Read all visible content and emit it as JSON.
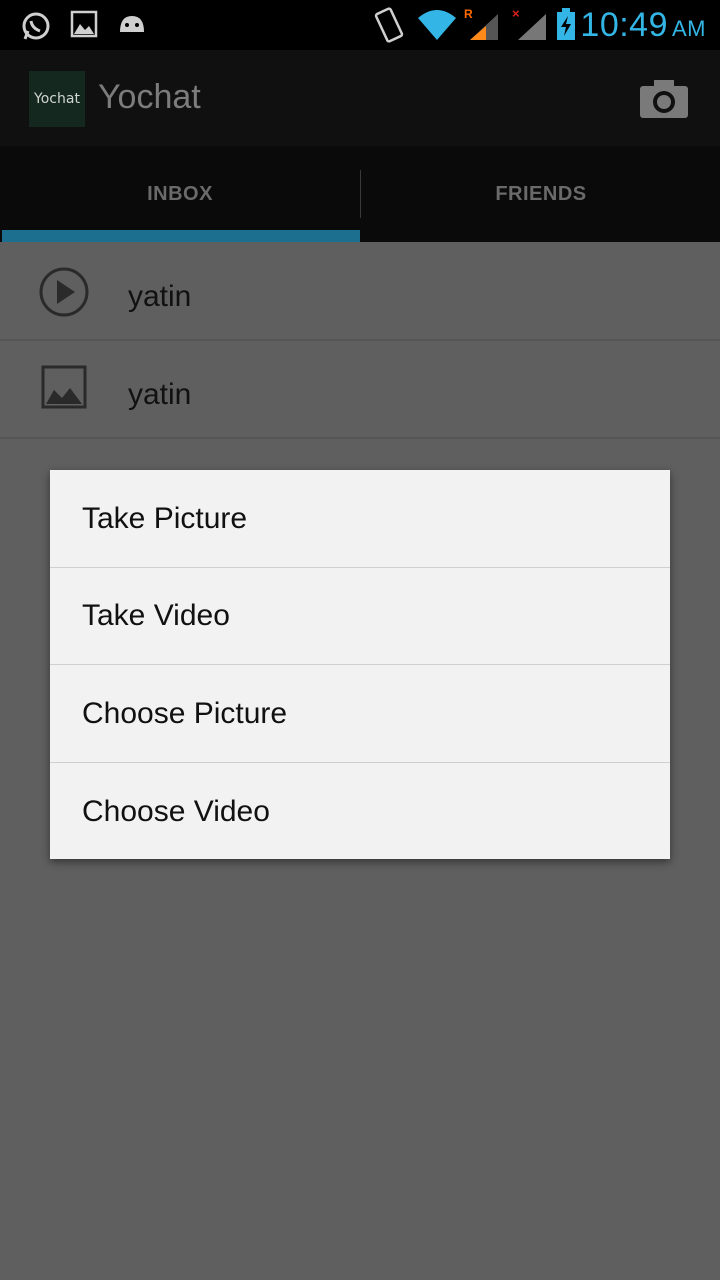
{
  "status_bar": {
    "icons": [
      "whatsapp-icon",
      "image-icon",
      "android-icon",
      "vibrate-icon",
      "wifi-icon",
      "signal-roaming-icon",
      "signal-noservice-icon",
      "battery-charging-icon"
    ],
    "time": "10:49",
    "ampm": "AM",
    "accent_color": "#33b5e5"
  },
  "action_bar": {
    "logo_text": "Yochat",
    "title": "Yochat",
    "camera_icon": "camera-icon"
  },
  "tabs": [
    {
      "label": "INBOX",
      "selected": true
    },
    {
      "label": "FRIENDS",
      "selected": false
    }
  ],
  "inbox": [
    {
      "icon": "play-icon",
      "sender": "yatin"
    },
    {
      "icon": "image-icon",
      "sender": "yatin"
    }
  ],
  "dialog": {
    "items": [
      "Take Picture",
      "Take Video",
      "Choose Picture",
      "Choose Video"
    ]
  }
}
